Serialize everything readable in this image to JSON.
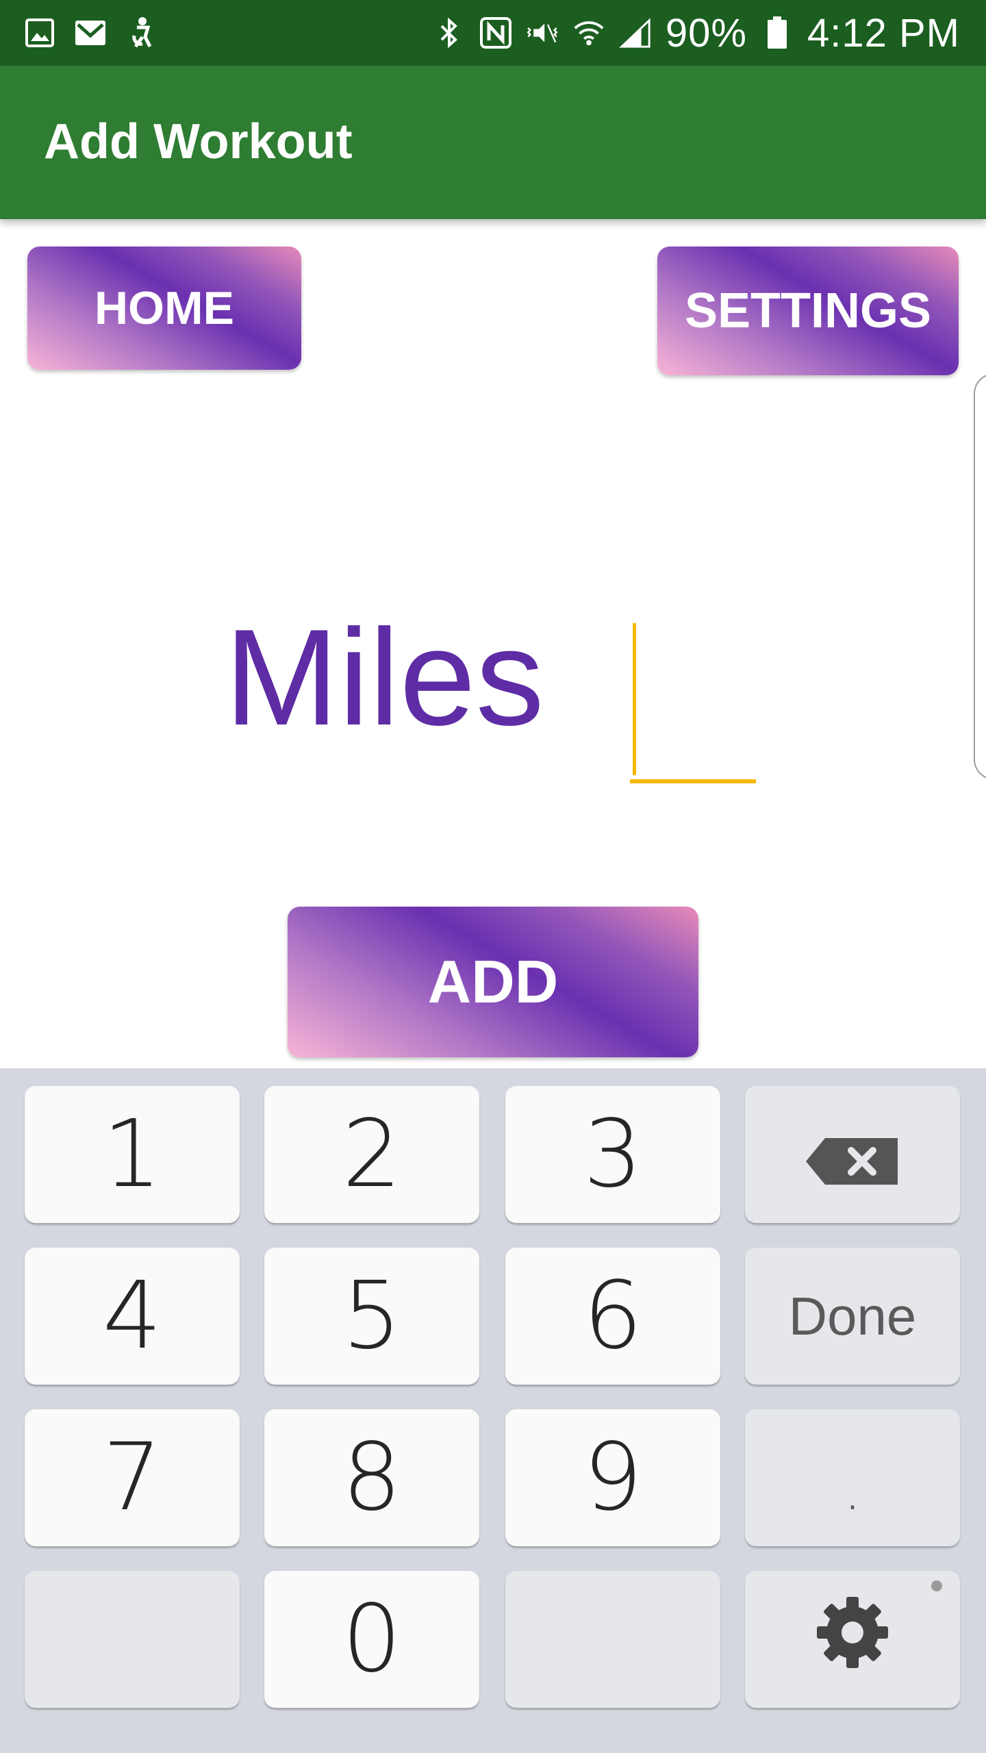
{
  "status_bar": {
    "battery": "90%",
    "time": "4:12 PM",
    "left_icons": [
      "gallery-icon",
      "mail-icon",
      "accessibility-icon"
    ],
    "right_icons": [
      "bluetooth-icon",
      "nfc-icon",
      "vibrate-icon",
      "wifi-icon",
      "signal-icon",
      "battery-icon"
    ]
  },
  "app_bar": {
    "title": "Add Workout",
    "color": "#2e7d32"
  },
  "buttons": {
    "home": "HOME",
    "settings": "SETTINGS",
    "add": "ADD"
  },
  "form": {
    "label": "Miles",
    "input_value": "",
    "label_color": "#5e2ca5",
    "underline_color": "#f5b800"
  },
  "keyboard": {
    "keys": [
      "1",
      "2",
      "3",
      "4",
      "5",
      "6",
      "7",
      "8",
      "9",
      "0",
      "."
    ],
    "done_label": "Done",
    "backspace_icon": "backspace-icon",
    "settings_icon": "gear-icon"
  }
}
